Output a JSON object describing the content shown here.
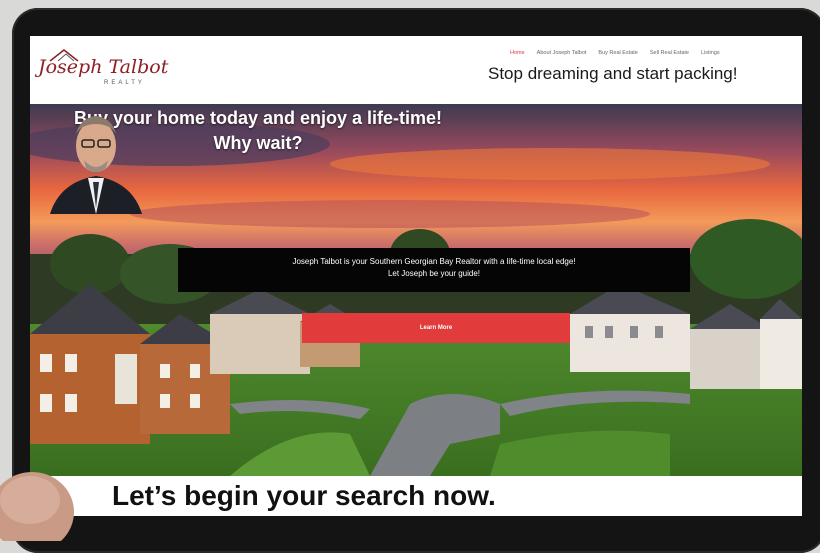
{
  "logo": {
    "name": "Joseph Talbot",
    "sub": "REALTY"
  },
  "nav": {
    "items": [
      "Home",
      "About Joseph Talbot",
      "Buy Real Estate",
      "Sell Real Estate",
      "Listings"
    ]
  },
  "header": {
    "tagline": "Stop dreaming and start packing!"
  },
  "hero": {
    "title_line1": "Buy your home today and enjoy a life-time!",
    "title_line2": "Why wait?",
    "info_line1": "Joseph Talbot is your Southern Georgian Bay Realtor with a life-time local edge!",
    "info_line2": "Let Joseph be your guide!",
    "cta_label": "Learn More"
  },
  "caption": {
    "text": "Let’s begin your search now."
  },
  "colors": {
    "accent": "#e23b3b",
    "brand": "#8e1f24"
  }
}
